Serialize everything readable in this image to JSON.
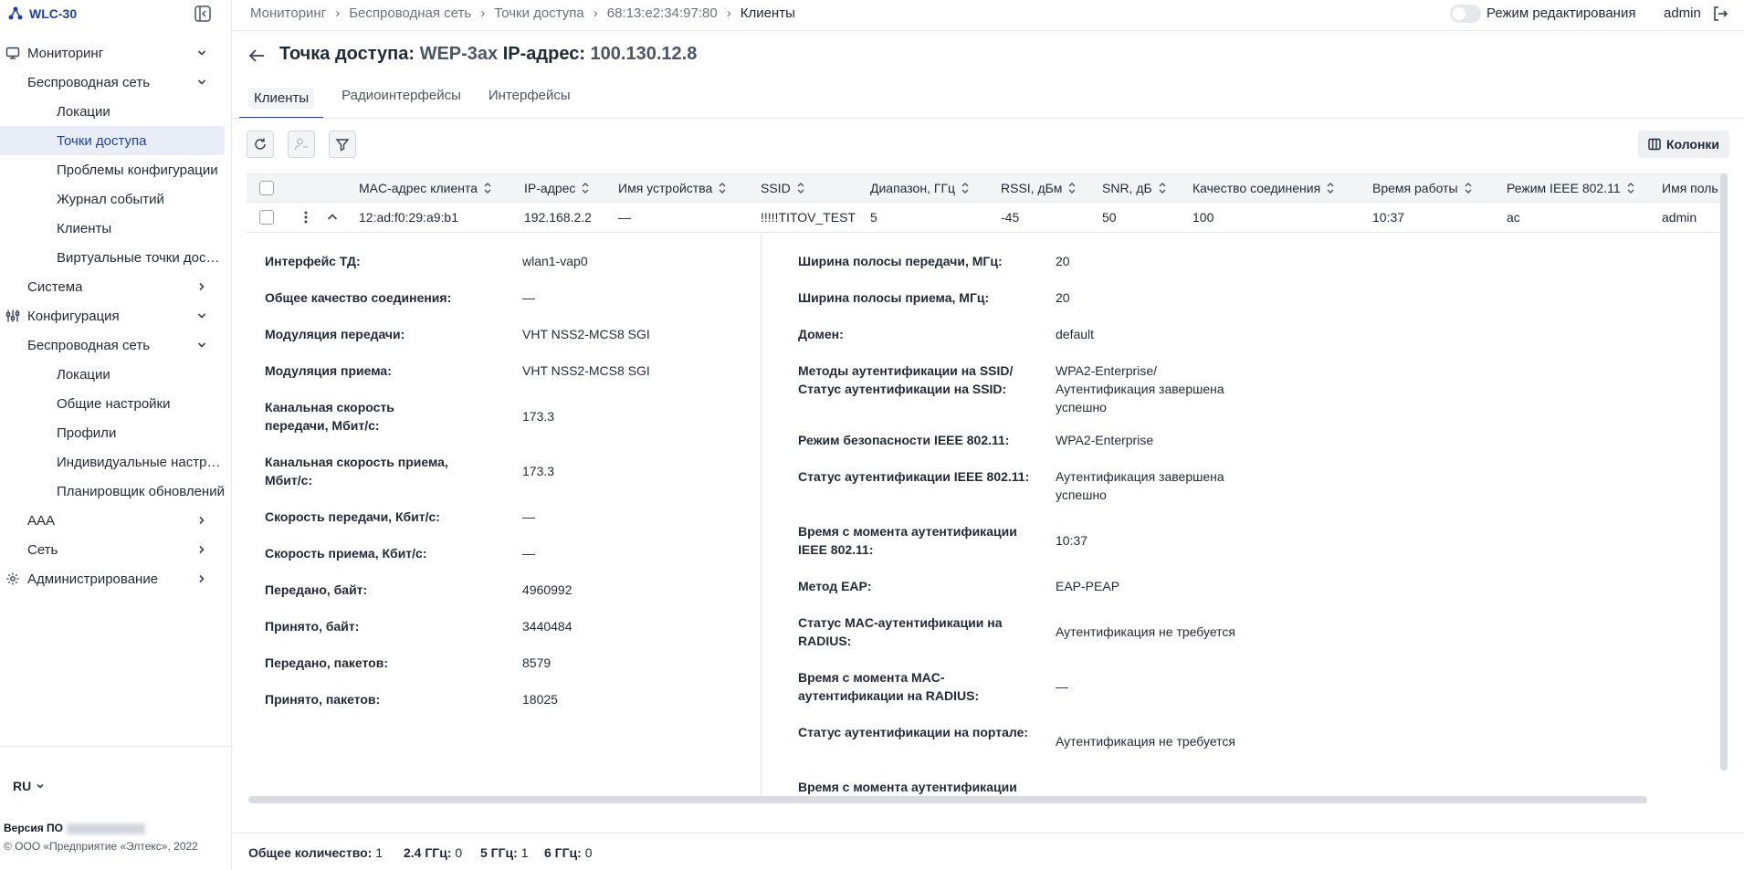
{
  "brand": {
    "name": "WLC-30"
  },
  "sidebar": {
    "items": [
      {
        "label": "Мониторинг",
        "icon": "monitor-icon",
        "level": 0,
        "chevron": "down"
      },
      {
        "label": "Беспроводная сеть",
        "level": 1,
        "chevron": "down"
      },
      {
        "label": "Локации",
        "level": 2
      },
      {
        "label": "Точки доступа",
        "level": 2,
        "active": true
      },
      {
        "label": "Проблемы конфигурации",
        "level": 2
      },
      {
        "label": "Журнал событий",
        "level": 2
      },
      {
        "label": "Клиенты",
        "level": 2
      },
      {
        "label": "Виртуальные точки доступа",
        "level": 2
      },
      {
        "label": "Система",
        "level": 1,
        "chevron": "right"
      },
      {
        "label": "Конфигурация",
        "icon": "sliders-icon",
        "level": 0,
        "chevron": "down"
      },
      {
        "label": "Беспроводная сеть",
        "level": 1,
        "chevron": "down"
      },
      {
        "label": "Локации",
        "level": 2
      },
      {
        "label": "Общие настройки",
        "level": 2
      },
      {
        "label": "Профили",
        "level": 2
      },
      {
        "label": "Индивидуальные настройки",
        "level": 2
      },
      {
        "label": "Планировщик обновлений",
        "level": 2
      },
      {
        "label": "AAA",
        "level": 1,
        "chevron": "right"
      },
      {
        "label": "Сеть",
        "level": 1,
        "chevron": "right"
      },
      {
        "label": "Администрирование",
        "icon": "gear-icon",
        "level": 0,
        "chevron": "right"
      }
    ],
    "lang": "RU",
    "version_label": "Версия ПО",
    "copyright": "© ООО «Предприятие «Элтекс», 2022"
  },
  "header": {
    "breadcrumb": [
      "Мониторинг",
      "Беспроводная сеть",
      "Точки доступа",
      "68:13:e2:34:97:80",
      "Клиенты"
    ],
    "edit_mode_label": "Режим редактирования",
    "user": "admin"
  },
  "page": {
    "title_prefix": "Точка доступа:",
    "ap_name": "WEP-3ax",
    "ip_label": "IP-адрес:",
    "ip": "100.130.12.8"
  },
  "tabs": [
    "Клиенты",
    "Радиоинтерфейсы",
    "Интерфейсы"
  ],
  "toolbar": {
    "columns_label": "Колонки"
  },
  "table": {
    "columns": [
      "MAC-адрес клиента",
      "IP-адрес",
      "Имя устройства",
      "SSID",
      "Диапазон, ГГц",
      "RSSI, дБм",
      "SNR, дБ",
      "Качество соединения",
      "Время работы",
      "Режим IEEE 802.11",
      "Имя поль"
    ],
    "row": [
      "12:ad:f0:29:a9:b1",
      "192.168.2.2",
      "—",
      "!!!!!TITOV_TEST",
      "5",
      "-45",
      "50",
      "100",
      "10:37",
      "ac",
      "admin"
    ]
  },
  "details": {
    "left": [
      {
        "label": "Интерфейс ТД:",
        "value": "wlan1-vap0"
      },
      {
        "label": "Общее качество соединения:",
        "value": "—"
      },
      {
        "label": "Модуляция передачи:",
        "value": "VHT NSS2-MCS8 SGI"
      },
      {
        "label": "Модуляция приема:",
        "value": "VHT NSS2-MCS8 SGI"
      },
      {
        "label": "Канальная скорость передачи, Мбит/с:",
        "value": "173.3"
      },
      {
        "label": "Канальная скорость приема, Мбит/с:",
        "value": "173.3"
      },
      {
        "label": "Скорость передачи, Кбит/с:",
        "value": "—"
      },
      {
        "label": "Скорость приема, Кбит/с:",
        "value": "—"
      },
      {
        "label": "Передано, байт:",
        "value": "4960992"
      },
      {
        "label": "Принято, байт:",
        "value": "3440484"
      },
      {
        "label": "Передано, пакетов:",
        "value": "8579"
      },
      {
        "label": "Принято, пакетов:",
        "value": "18025"
      }
    ],
    "right": [
      {
        "label": "Ширина полосы передачи, МГц:",
        "value": "20"
      },
      {
        "label": "Ширина полосы приема, МГц:",
        "value": "20"
      },
      {
        "label": "Домен:",
        "value": "default"
      },
      {
        "label": "Методы аутентификации на SSID/ Статус аутентификации на SSID:",
        "value": "WPA2-Enterprise/ Аутентификация завершена успешно"
      },
      {
        "label": "Режим безопасности IEEE 802.11:",
        "value": "WPA2-Enterprise"
      },
      {
        "label": "Статус аутентификации IEEE 802.11:",
        "value": "Аутентификация завершена успешно"
      },
      {
        "label": "Время с момента аутентификации IEEE 802.11:",
        "value": "10:37"
      },
      {
        "label": "Метод EAP:",
        "value": "EAP-PEAP"
      },
      {
        "label": "Статус MAC-аутентификации на RADIUS:",
        "value": "Аутентификация не требуется"
      },
      {
        "label": "Время с момента MAC-аутентификации на RADIUS:",
        "value": "—"
      },
      {
        "label": "Статус аутентификации на портале:",
        "value": "Аутентификация не требуется"
      },
      {
        "label": "Время с момента аутентификации",
        "value": ""
      }
    ]
  },
  "footer": {
    "total_label": "Общее количество:",
    "total": "1",
    "g24_label": "2.4 ГГц:",
    "g24": "0",
    "g5_label": "5 ГГц:",
    "g5": "1",
    "g6_label": "6 ГГц:",
    "g6": "0"
  }
}
